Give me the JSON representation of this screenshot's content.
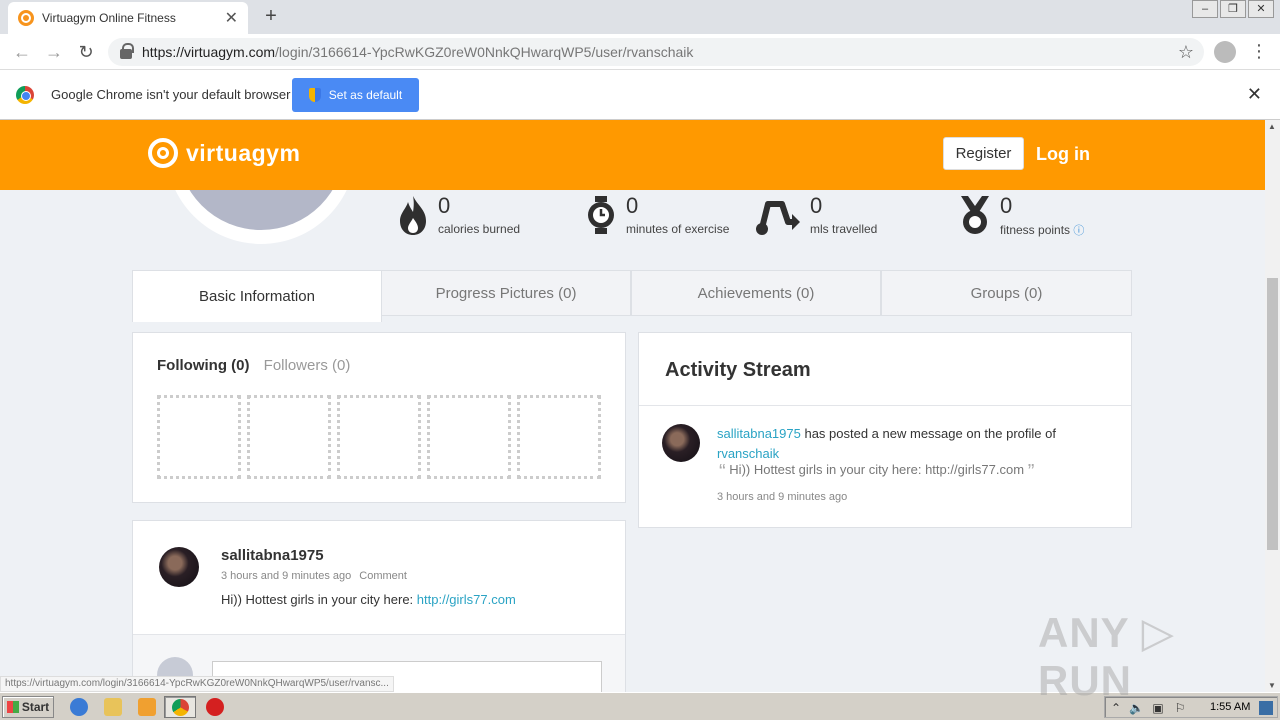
{
  "browser": {
    "tab_title": "Virtuagym Online Fitness",
    "tab_close": "✕",
    "new_tab": "+",
    "url_host": "https://virtuagym.com",
    "url_path": "/login/3166614-YpcRwKGZ0reW0NnkQHwarqWP5/user/rvanschaik",
    "infobar_message": "Google Chrome isn't your default browser",
    "set_default_label": "Set as default",
    "infobar_close": "✕",
    "status_url": "https://virtuagym.com/login/3166614-YpcRwKGZ0reW0NnkQHwarqWP5/user/rvansc..."
  },
  "header": {
    "logo_text": "virtuagym",
    "register_label": "Register",
    "login_label": "Log in",
    "brand_color": "#ff9900"
  },
  "stats": [
    {
      "icon": "flame-icon",
      "value": "0",
      "label": "calories burned"
    },
    {
      "icon": "stopwatch-icon",
      "value": "0",
      "label": "minutes of exercise"
    },
    {
      "icon": "route-icon",
      "value": "0",
      "label": "mls travelled"
    },
    {
      "icon": "medal-icon",
      "value": "0",
      "label": "fitness points",
      "info": "ⓘ"
    }
  ],
  "profile_tabs": [
    {
      "label": "Basic Information",
      "active": true
    },
    {
      "label": "Progress Pictures (0)",
      "active": false
    },
    {
      "label": "Achievements (0)",
      "active": false
    },
    {
      "label": "Groups (0)",
      "active": false
    }
  ],
  "follow": {
    "following_label": "Following (0)",
    "followers_label": "Followers (0)"
  },
  "post": {
    "author": "sallitabna1975",
    "time": "3 hours and 9 minutes ago",
    "comment_label": "Comment",
    "text_prefix": "Hi)) Hottest girls in your city here: ",
    "link": "http://girls77.com"
  },
  "activity": {
    "title": "Activity Stream",
    "actor": "sallitabna1975",
    "action": " has posted a new message on the profile of ",
    "target": "rvanschaik",
    "quote": "Hi)) Hottest girls in your city here: http://girls77.com",
    "time": "3 hours and 9 minutes ago"
  },
  "taskbar": {
    "start_label": "Start",
    "clock": "1:55 AM"
  },
  "watermark": "ANY ▷ RUN"
}
